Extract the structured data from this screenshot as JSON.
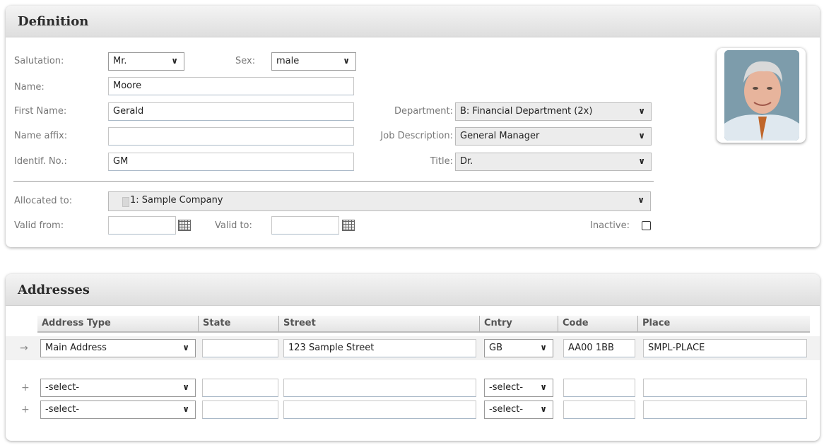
{
  "definition": {
    "title": "Definition",
    "salutation": {
      "label": "Salutation:",
      "value": "Mr."
    },
    "sex": {
      "label": "Sex:",
      "value": "male"
    },
    "name": {
      "label": "Name:",
      "value": "Moore"
    },
    "first_name": {
      "label": "First Name:",
      "value": "Gerald"
    },
    "name_affix": {
      "label": "Name affix:",
      "value": ""
    },
    "identif_no": {
      "label": "Identif. No.:",
      "value": "GM"
    },
    "department": {
      "label": "Department:",
      "value": "B: Financial Department (2x)"
    },
    "job_description": {
      "label": "Job Description:",
      "value": "General Manager"
    },
    "title_field": {
      "label": "Title:",
      "value": "Dr."
    },
    "allocated_to": {
      "label": "Allocated to:",
      "value": "1: Sample Company"
    },
    "valid_from": {
      "label": "Valid from:",
      "value": ""
    },
    "valid_to": {
      "label": "Valid to:",
      "value": ""
    },
    "inactive": {
      "label": "Inactive:",
      "checked": false
    }
  },
  "addresses": {
    "title": "Addresses",
    "columns": [
      "Address Type",
      "State",
      "Street",
      "Cntry",
      "Code",
      "Place"
    ],
    "rows": [
      {
        "marker": "→",
        "address_type": "Main Address",
        "state": "",
        "street": "123 Sample Street",
        "country": "GB",
        "code": "AA00 1BB",
        "place": "SMPL-PLACE"
      },
      {
        "marker": "+",
        "address_type": "-select-",
        "state": "",
        "street": "",
        "country": "-select-",
        "code": "",
        "place": ""
      },
      {
        "marker": "+",
        "address_type": "-select-",
        "state": "",
        "street": "",
        "country": "-select-",
        "code": "",
        "place": ""
      }
    ]
  },
  "icons": {
    "dropdown": "chevron-down-icon",
    "calendar": "calendar-icon",
    "company": "building-icon",
    "add_row": "plus-icon",
    "current_row": "arrow-right-icon"
  },
  "colors": {
    "header_bg": "#e4e4e4",
    "select_bg": "#ececec",
    "input_border": "#c6c6c6"
  }
}
